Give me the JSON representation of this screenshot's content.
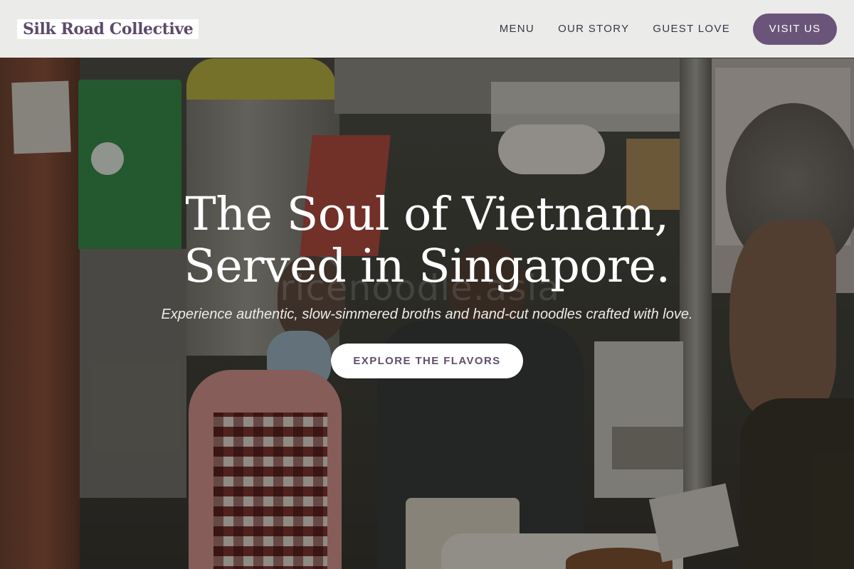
{
  "header": {
    "brand": "Silk Road Collective",
    "nav": [
      {
        "label": "MENU"
      },
      {
        "label": "OUR STORY"
      },
      {
        "label": "GUEST LOVE"
      }
    ],
    "cta_label": "VISIT US"
  },
  "hero": {
    "headline_line1": "The Soul of Vietnam,",
    "headline_line2": "Served in Singapore.",
    "subtitle": "Experience authentic, slow-simmered broths and hand-cut noodles crafted with love.",
    "cta_label": "EXPLORE THE FLAVORS",
    "watermark": "ricenoodle.asia",
    "image_alt": "hawker-stall-noodle-makers-photo"
  },
  "colors": {
    "brand": "#5d4b6a",
    "accent": "#6b5479",
    "header_bg": "#f6f5f3",
    "hero_text": "#ffffff"
  }
}
